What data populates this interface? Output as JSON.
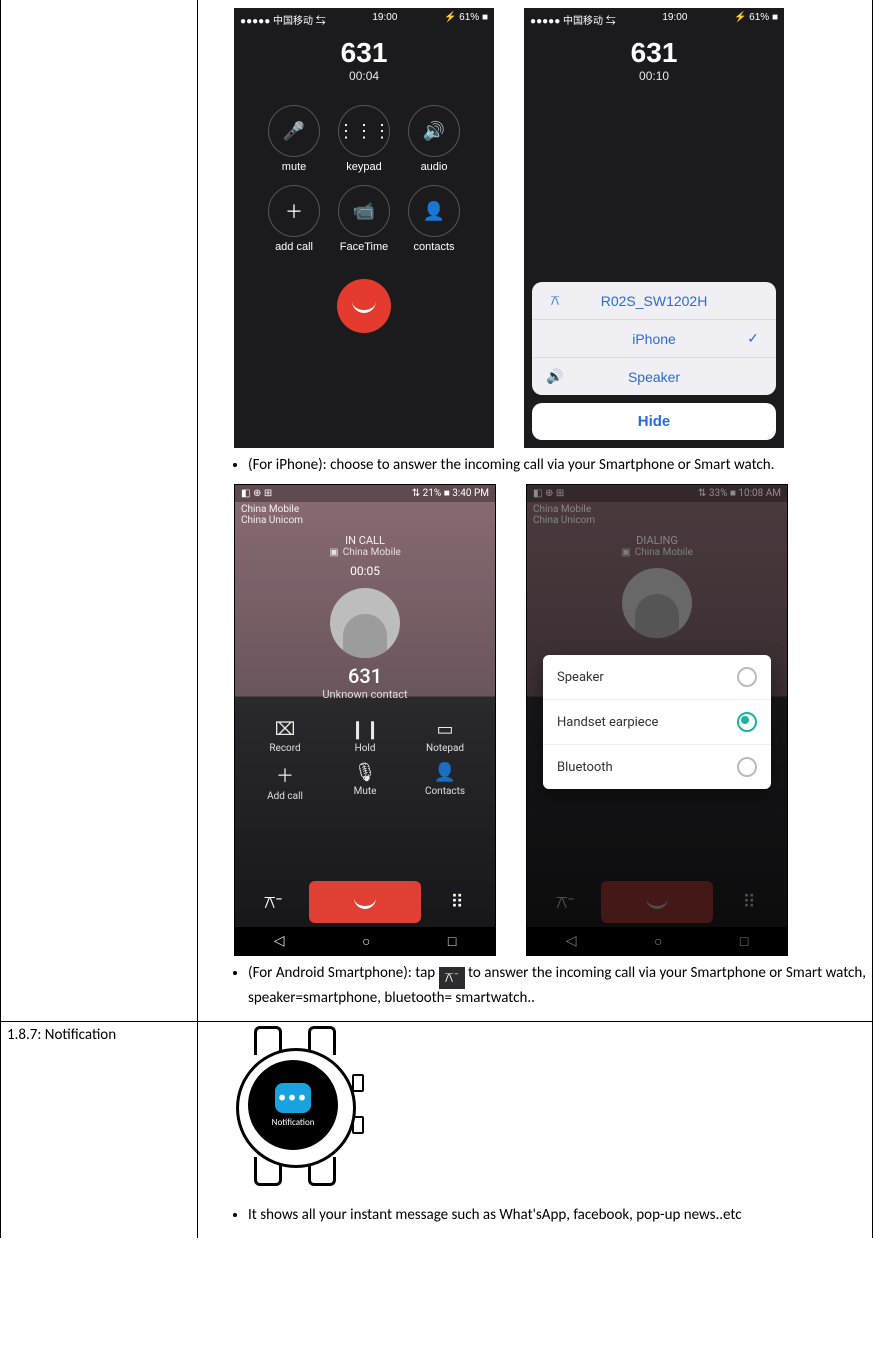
{
  "sections": {
    "notification_heading": "1.8.7: Notification"
  },
  "bullets": {
    "iphone": "(For iPhone): choose to answer the incoming call via your Smartphone or Smart watch.",
    "android_pre": "(For Android Smartphone): tap ",
    "android_post": "to answer the incoming call via your Smartphone or Smart watch, speaker=smartphone, bluetooth= smartwatch..",
    "notification": "It shows all your instant message such as What'sApp, facebook, pop-up news..etc"
  },
  "iphone_left": {
    "status_left": "●●●●● 中国移动 ⇆",
    "status_time": "19:00",
    "status_right": "⚡ 61% ■",
    "number": "631",
    "duration": "00:04",
    "cells": {
      "mute": {
        "label": "mute",
        "glyph": "🎤"
      },
      "keypad": {
        "label": "keypad",
        "glyph": "⋮⋮⋮"
      },
      "audio": {
        "label": "audio",
        "glyph": "🔊"
      },
      "add": {
        "label": "add call",
        "glyph": "＋"
      },
      "ft": {
        "label": "FaceTime",
        "glyph": "📹"
      },
      "contacts": {
        "label": "contacts",
        "glyph": "👤"
      }
    }
  },
  "iphone_right": {
    "status_left": "●●●●● 中国移动 ⇆",
    "status_time": "19:00",
    "status_right": "⚡ 61% ■",
    "number": "631",
    "duration": "00:10",
    "sheet": {
      "opt1": "R02S_SW1202H",
      "opt2": "iPhone",
      "opt3": "Speaker",
      "hide": "Hide",
      "check": "✓"
    }
  },
  "android_left": {
    "carrier": "China Mobile\nChina Unicom",
    "status_right": "⇅ 21% ■ 3:40 PM",
    "in_call": "IN CALL",
    "sim": "China Mobile",
    "duration": "00:05",
    "number": "631",
    "unknown": "Unknown contact",
    "fn": {
      "record": {
        "label": "Record",
        "glyph": "⌧"
      },
      "hold": {
        "label": "Hold",
        "glyph": "❙❙"
      },
      "notepad": {
        "label": "Notepad",
        "glyph": "▭"
      },
      "addcall": {
        "label": "Add call",
        "glyph": "＋"
      },
      "mute": {
        "label": "Mute",
        "glyph": "🎙"
      },
      "contacts": {
        "label": "Contacts",
        "glyph": "👤"
      }
    },
    "bt_glyph": "⚻⁻",
    "dial_glyph": "⠿"
  },
  "android_right": {
    "carrier": "China Mobile\nChina Unicom",
    "status_right": "⇅ 33% ■ 10:08 AM",
    "in_call": "DIALING",
    "sim": "China Mobile",
    "popup": {
      "opt1": "Speaker",
      "opt2": "Handset earpiece",
      "opt3": "Bluetooth"
    }
  },
  "watch": {
    "dots": "•••",
    "caption": "Notification"
  },
  "inline_bt_glyph": "⚻⁻"
}
